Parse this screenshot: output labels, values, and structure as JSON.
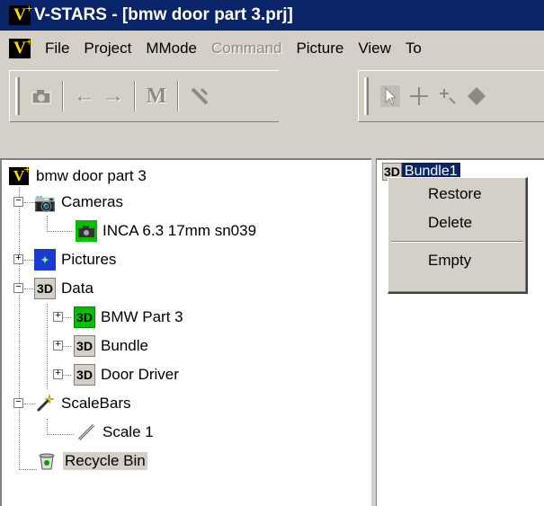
{
  "window": {
    "logo": "V",
    "title": "V-STARS - [bmw door part 3.prj]"
  },
  "menubar": {
    "logo": "V",
    "items": [
      {
        "label": "File",
        "disabled": false
      },
      {
        "label": "Project",
        "disabled": false
      },
      {
        "label": "MMode",
        "disabled": false
      },
      {
        "label": "Command",
        "disabled": true
      },
      {
        "label": "Picture",
        "disabled": false
      },
      {
        "label": "View",
        "disabled": false
      },
      {
        "label": "To",
        "disabled": false
      }
    ]
  },
  "toolbar1": {
    "icons": [
      "camera-icon",
      "arrow-left-icon",
      "arrow-right-icon",
      "m-icon",
      "measure-icon"
    ],
    "m_glyph": "M"
  },
  "toolbar2": {
    "icons": [
      "pointer-icon",
      "crosshair-icon",
      "point-icon",
      "diamond-icon"
    ]
  },
  "tree": {
    "root": {
      "logo": "V",
      "label": "bmw door part 3"
    },
    "cameras": {
      "label": "Cameras",
      "children": [
        {
          "label": "INCA 6.3 17mm sn039"
        }
      ]
    },
    "pictures": {
      "label": "Pictures"
    },
    "data": {
      "label": "Data",
      "icon_text": "3D",
      "children": [
        {
          "label": "BMW Part 3",
          "icon_text": "3D"
        },
        {
          "label": "Bundle",
          "icon_text": "3D"
        },
        {
          "label": "Door Driver",
          "icon_text": "3D"
        }
      ]
    },
    "scalebars": {
      "label": "ScaleBars",
      "children": [
        {
          "label": "Scale 1"
        }
      ]
    },
    "recycle": {
      "label": "Recycle Bin"
    }
  },
  "right_list": {
    "items": [
      {
        "icon_text": "3D",
        "label": "Bundle1"
      }
    ]
  },
  "context_menu": {
    "restore": "Restore",
    "delete": "Delete",
    "empty": "Empty"
  },
  "colors": {
    "titlebar": "#0a246a",
    "face": "#d4d0c8",
    "selection": "#0a246a"
  }
}
